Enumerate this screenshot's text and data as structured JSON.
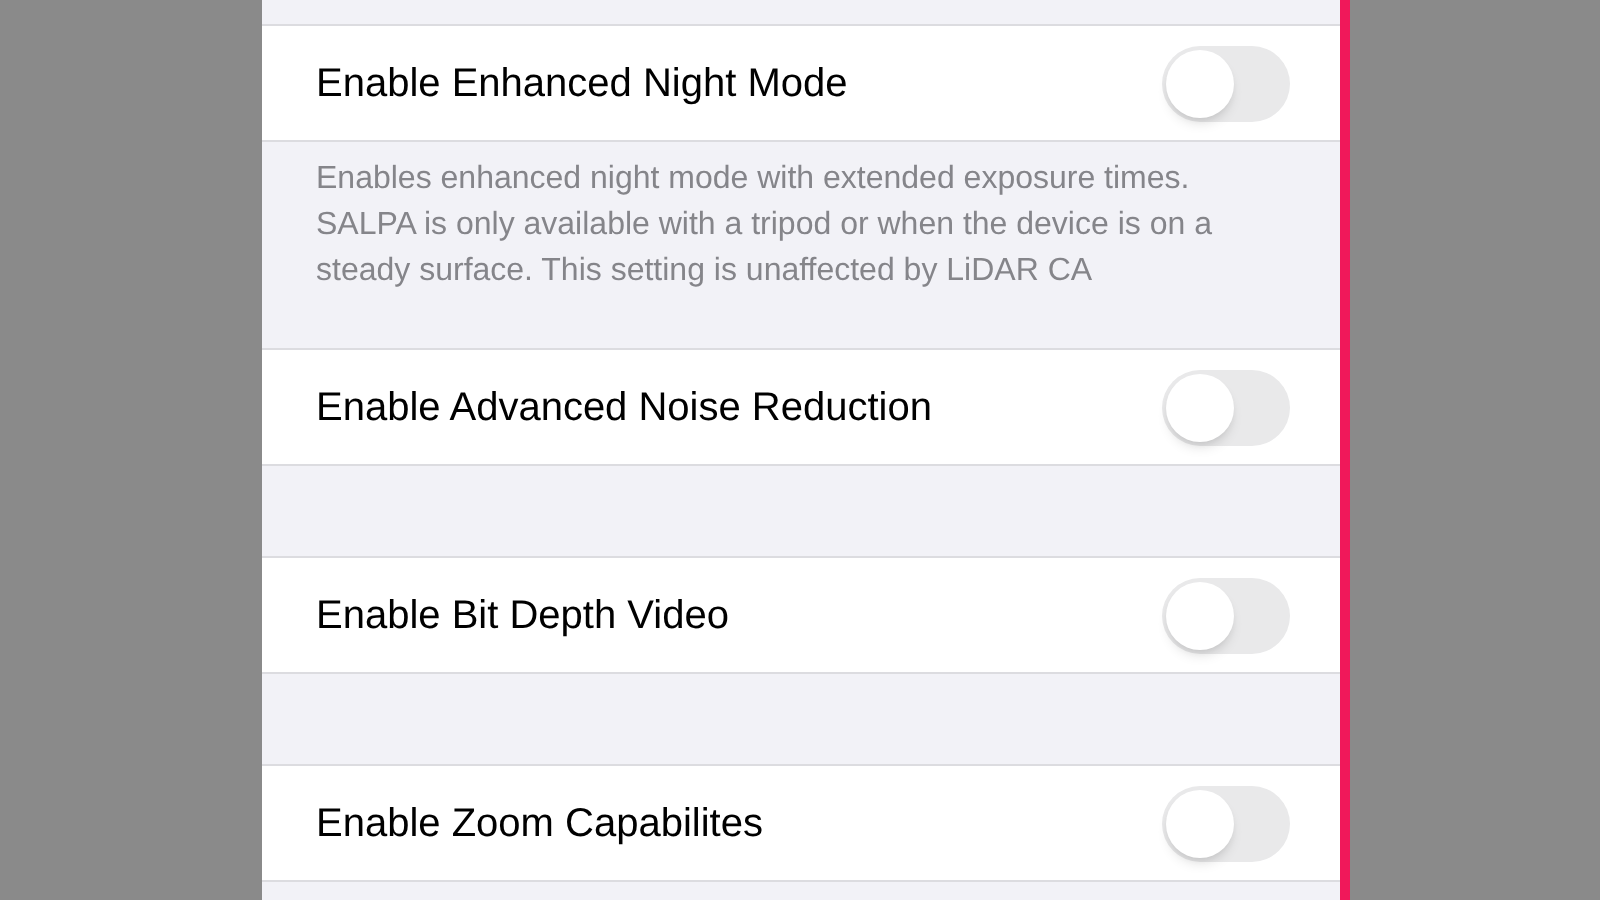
{
  "sections": [
    {
      "rows": [
        {
          "label": "Enable Enhanced Night Mode",
          "on": false
        }
      ],
      "footer": "Enables enhanced night mode with extended exposure times. SALPA is only available with a tripod or when the device is on a steady surface. This setting is unaffected by LiDAR CA"
    },
    {
      "rows": [
        {
          "label": "Enable Advanced Noise Reduction",
          "on": false
        }
      ]
    },
    {
      "rows": [
        {
          "label": "Enable Bit Depth Video",
          "on": false
        }
      ]
    },
    {
      "rows": [
        {
          "label": "Enable Zoom Capabilites",
          "on": false
        }
      ]
    }
  ]
}
